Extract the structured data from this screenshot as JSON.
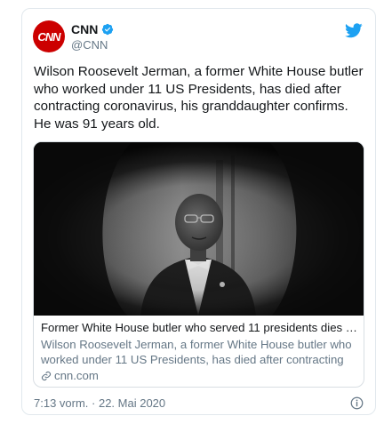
{
  "account": {
    "name": "CNN",
    "handle": "@CNN",
    "avatar_text": "CNN",
    "verified": true,
    "brand_color": "#cc0000"
  },
  "tweet": {
    "text": "Wilson Roosevelt Jerman, a former White House butler who worked under 11 US Presidents, has died after contracting coronavirus, his granddaughter confirms. He was 91 years old.",
    "timestamp": "7:13 vorm. · 22. Mai 2020"
  },
  "link_card": {
    "title": "Former White House butler who served 11 presidents dies …",
    "description": "Wilson Roosevelt Jerman, a former White House butler who worked under 11 US Presidents, has died after contracting",
    "domain": "cnn.com"
  },
  "icons": {
    "verified": "verified-badge-icon",
    "platform": "twitter-bird-icon",
    "link": "link-icon",
    "info": "info-icon"
  },
  "colors": {
    "twitter_blue": "#1da1f2",
    "secondary_text": "#657786",
    "border": "#e1e8ed"
  }
}
